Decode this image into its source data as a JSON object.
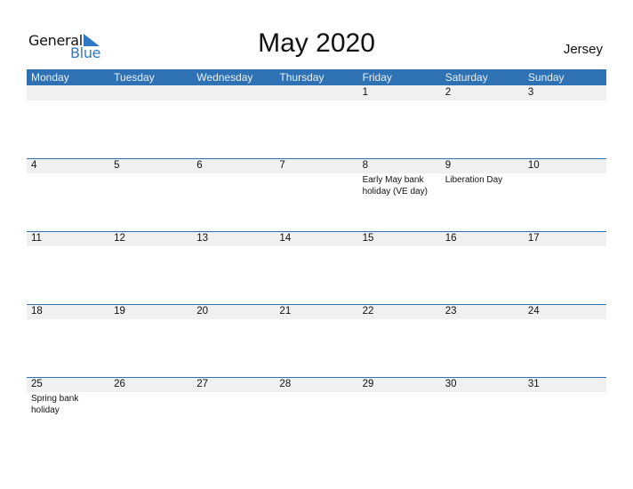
{
  "logo": {
    "line1": "General",
    "line2": "Blue",
    "icon": "triangle-flag-icon",
    "accent": "#2f78c4"
  },
  "title": "May 2020",
  "country": "Jersey",
  "colors": {
    "header_bg": "#2e72b3",
    "band_bg": "#f0f0f0"
  },
  "weekdays": [
    "Monday",
    "Tuesday",
    "Wednesday",
    "Thursday",
    "Friday",
    "Saturday",
    "Sunday"
  ],
  "weeks": [
    {
      "days": [
        "",
        "",
        "",
        "",
        "1",
        "2",
        "3"
      ],
      "events": [
        "",
        "",
        "",
        "",
        "",
        "",
        ""
      ]
    },
    {
      "days": [
        "4",
        "5",
        "6",
        "7",
        "8",
        "9",
        "10"
      ],
      "events": [
        "",
        "",
        "",
        "",
        "Early May bank holiday (VE day)",
        "Liberation Day",
        ""
      ]
    },
    {
      "days": [
        "11",
        "12",
        "13",
        "14",
        "15",
        "16",
        "17"
      ],
      "events": [
        "",
        "",
        "",
        "",
        "",
        "",
        ""
      ]
    },
    {
      "days": [
        "18",
        "19",
        "20",
        "21",
        "22",
        "23",
        "24"
      ],
      "events": [
        "",
        "",
        "",
        "",
        "",
        "",
        ""
      ]
    },
    {
      "days": [
        "25",
        "26",
        "27",
        "28",
        "29",
        "30",
        "31"
      ],
      "events": [
        "Spring bank holiday",
        "",
        "",
        "",
        "",
        "",
        ""
      ]
    }
  ]
}
